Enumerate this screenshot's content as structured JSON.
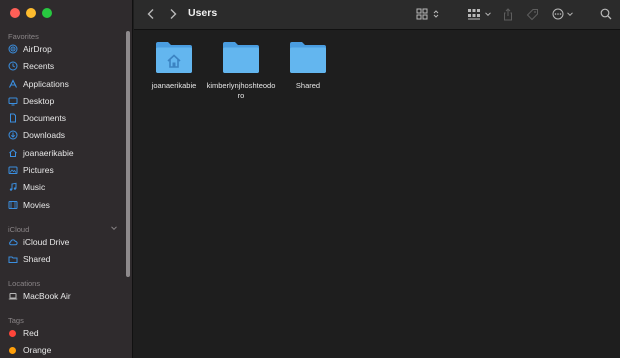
{
  "window": {
    "title": "Users"
  },
  "sidebar": {
    "sections": {
      "favorites": "Favorites",
      "icloud": "iCloud",
      "locations": "Locations",
      "tags": "Tags"
    },
    "favorites": [
      {
        "label": "AirDrop",
        "icon": "airdrop-icon"
      },
      {
        "label": "Recents",
        "icon": "clock-icon"
      },
      {
        "label": "Applications",
        "icon": "applications-icon"
      },
      {
        "label": "Desktop",
        "icon": "desktop-icon"
      },
      {
        "label": "Documents",
        "icon": "document-icon"
      },
      {
        "label": "Downloads",
        "icon": "download-icon"
      },
      {
        "label": "joanaerikabie",
        "icon": "home-icon"
      },
      {
        "label": "Pictures",
        "icon": "pictures-icon"
      },
      {
        "label": "Music",
        "icon": "music-icon"
      },
      {
        "label": "Movies",
        "icon": "movies-icon"
      }
    ],
    "icloud": [
      {
        "label": "iCloud Drive",
        "icon": "cloud-icon"
      },
      {
        "label": "Shared",
        "icon": "shared-folder-icon"
      }
    ],
    "locations": [
      {
        "label": "MacBook Air",
        "icon": "laptop-icon"
      }
    ],
    "tags": [
      {
        "label": "Red",
        "color": "#ff453a"
      },
      {
        "label": "Orange",
        "color": "#ff9f0a"
      }
    ]
  },
  "folders": [
    {
      "label": "joanaerikabie",
      "icon": "home-folder-icon"
    },
    {
      "label": "kimberlynjhoshteodoro",
      "icon": "folder-icon"
    },
    {
      "label": "Shared",
      "icon": "folder-icon"
    }
  ],
  "colors": {
    "folder": "#5aaee8",
    "accent": "#3b8fe0"
  }
}
